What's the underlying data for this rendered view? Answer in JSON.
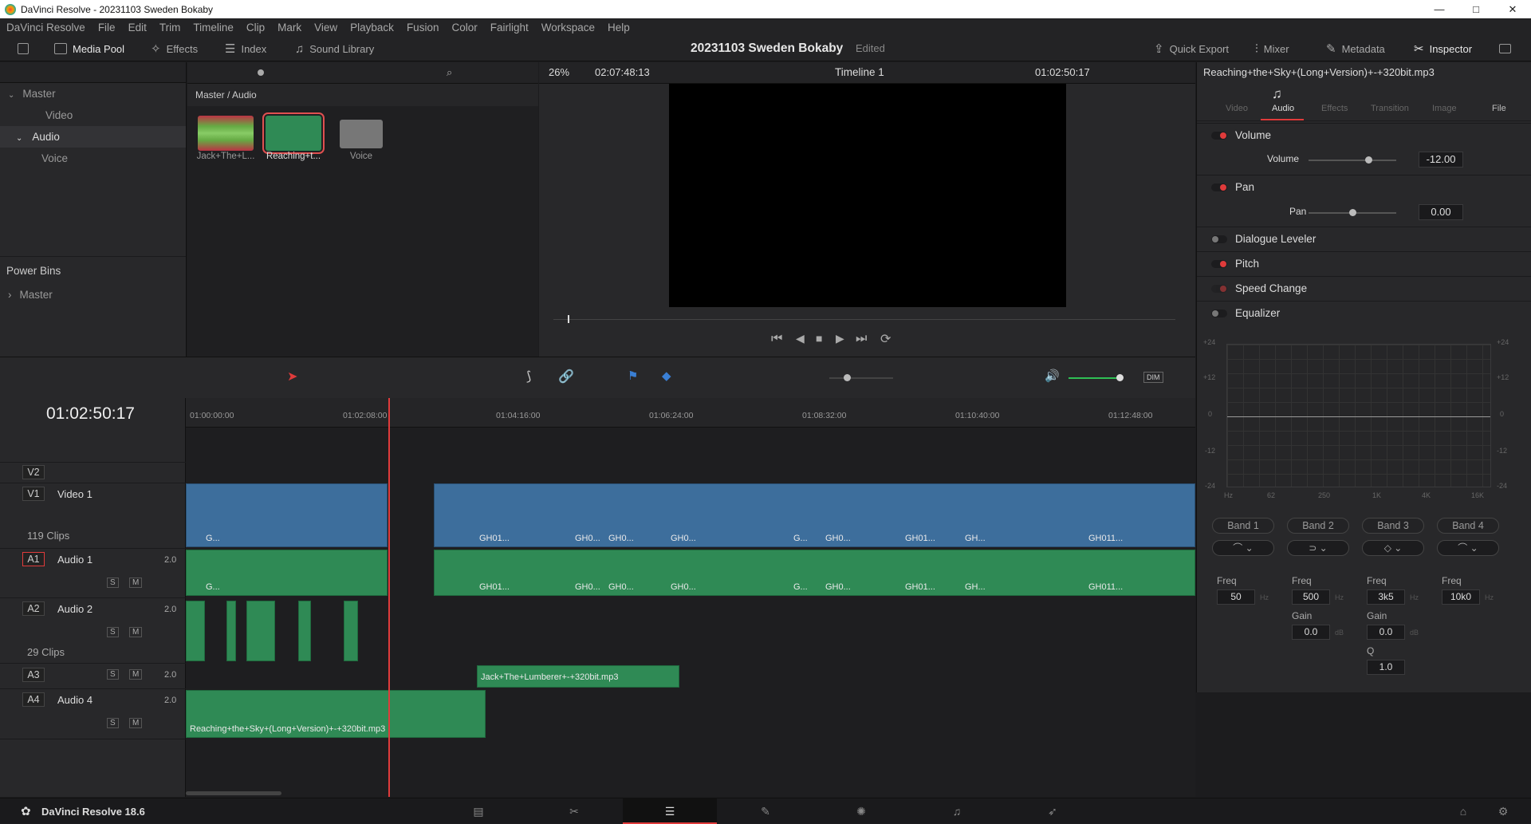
{
  "window": {
    "title": "DaVinci Resolve - 20231103 Sweden Bokaby",
    "controls": [
      "—",
      "□",
      "✕"
    ]
  },
  "menu": [
    "DaVinci Resolve",
    "File",
    "Edit",
    "Trim",
    "Timeline",
    "Clip",
    "Mark",
    "View",
    "Playback",
    "Fusion",
    "Color",
    "Fairlight",
    "Workspace",
    "Help"
  ],
  "toolbar": {
    "media_pool": "Media Pool",
    "effects": "Effects",
    "index": "Index",
    "sound_library": "Sound Library",
    "project_title": "20231103 Sweden Bokaby",
    "project_status": "Edited",
    "quick_export": "Quick Export",
    "mixer": "Mixer",
    "metadata": "Metadata",
    "inspector": "Inspector"
  },
  "bins": {
    "items": [
      {
        "label": "Master",
        "level": 0,
        "arrow": "chevron-down"
      },
      {
        "label": "Video",
        "level": 1
      },
      {
        "label": "Audio",
        "level": 1,
        "selected": true,
        "arrow": "chevron-down"
      },
      {
        "label": "Voice",
        "level": 2
      }
    ],
    "power_bins": "Power Bins",
    "power_master": "Master"
  },
  "media": {
    "path": "Master / Audio",
    "items": [
      {
        "label": "Jack+The+L..."
      },
      {
        "label": "Reaching+t..."
      },
      {
        "label": "Voice"
      }
    ]
  },
  "viewer": {
    "zoom": "26%",
    "source_tc": "02:07:48:13",
    "timeline_name": "Timeline 1",
    "timecode": "01:02:50:17"
  },
  "inspector": {
    "clip_name": "Reaching+the+Sky+(Long+Version)+-+320bit.mp3",
    "tabs": [
      "Video",
      "Audio",
      "Effects",
      "Transition",
      "Image",
      "File"
    ],
    "active_tab": "Audio",
    "volume": {
      "title": "Volume",
      "param": "Volume",
      "value": "-12.00",
      "level": 0.68
    },
    "pan": {
      "title": "Pan",
      "param": "Pan",
      "value": "0.00",
      "level": 0.5
    },
    "sections": [
      "Dialogue Leveler",
      "Pitch",
      "Speed Change",
      "Equalizer"
    ],
    "eq": {
      "db_labels": [
        "+24",
        "+12",
        "0",
        "-12",
        "-24"
      ],
      "freq_labels": [
        "Hz",
        "62",
        "250",
        "1K",
        "4K",
        "16K"
      ],
      "bands": [
        {
          "name": "Band 1",
          "freq": "50",
          "unit": "Hz"
        },
        {
          "name": "Band 2",
          "freq": "500",
          "unit": "Hz",
          "gain": "0.0"
        },
        {
          "name": "Band 3",
          "freq": "3k5",
          "unit": "Hz",
          "gain": "0.0",
          "q": "1.0"
        },
        {
          "name": "Band 4",
          "freq": "10k0",
          "unit": "Hz"
        }
      ],
      "freq_label": "Freq",
      "gain_label": "Gain",
      "q_label": "Q",
      "db_unit": "dB"
    }
  },
  "timeline": {
    "timecode": "01:02:50:17",
    "ruler": [
      "01:00:00:00",
      "01:02:08:00",
      "01:04:16:00",
      "01:06:24:00",
      "01:08:32:00",
      "01:10:40:00",
      "01:12:48:00"
    ],
    "tracks": [
      {
        "tag": "V2",
        "name": ""
      },
      {
        "tag": "V1",
        "name": "Video 1",
        "count": "119 Clips"
      },
      {
        "tag": "A1",
        "name": "Audio 1",
        "ch": "2.0"
      },
      {
        "tag": "A2",
        "name": "Audio 2",
        "ch": "2.0",
        "count": "29 Clips"
      },
      {
        "tag": "A3",
        "name": "",
        "ch": "2.0"
      },
      {
        "tag": "A4",
        "name": "Audio 4",
        "ch": "2.0"
      }
    ],
    "clips": {
      "g": "G...",
      "gh01": "GH01...",
      "gh0": "GH0...",
      "gh": "GH...",
      "gh011": "GH011...",
      "jack": "Jack+The+Lumberer+-+320bit.mp3",
      "reaching": "Reaching+the+Sky+(Long+Version)+-+320bit.mp3"
    },
    "solo": "S",
    "mute": "M",
    "dim": "DIM"
  },
  "footer": {
    "app": "DaVinci Resolve 18.6"
  }
}
